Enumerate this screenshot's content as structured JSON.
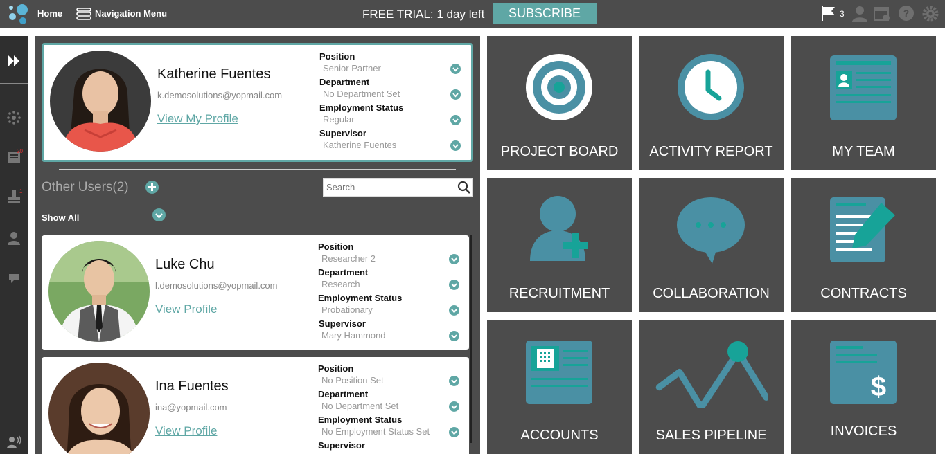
{
  "topbar": {
    "home": "Home",
    "nav_menu": "Navigation Menu",
    "trial": "FREE TRIAL: 1 day left",
    "subscribe": "SUBSCRIBE",
    "flag_count": "3"
  },
  "sidebar": {
    "badge_1": "20",
    "badge_2": "1"
  },
  "current_user": {
    "name": "Katherine Fuentes",
    "email": "k.demosolutions@yopmail.com",
    "link": "View My Profile",
    "fields": [
      {
        "label": "Position",
        "value": "Senior Partner"
      },
      {
        "label": "Department",
        "value": "No Department Set"
      },
      {
        "label": "Employment Status",
        "value": "Regular"
      },
      {
        "label": "Supervisor",
        "value": "Katherine Fuentes"
      }
    ]
  },
  "other_users": {
    "title": "Other Users(2)",
    "search_placeholder": "Search",
    "show_all": "Show All",
    "users": [
      {
        "name": "Luke Chu",
        "email": "l.demosolutions@yopmail.com",
        "link": "View Profile",
        "fields": [
          {
            "label": "Position",
            "value": "Researcher 2"
          },
          {
            "label": "Department",
            "value": "Research"
          },
          {
            "label": "Employment Status",
            "value": "Probationary"
          },
          {
            "label": "Supervisor",
            "value": "Mary Hammond"
          }
        ]
      },
      {
        "name": "Ina Fuentes",
        "email": "ina@yopmail.com",
        "link": "View Profile",
        "fields": [
          {
            "label": "Position",
            "value": "No Position Set"
          },
          {
            "label": "Department",
            "value": "No Department Set"
          },
          {
            "label": "Employment Status",
            "value": "No Employment Status Set"
          },
          {
            "label": "Supervisor",
            "value": ""
          }
        ]
      }
    ]
  },
  "tiles": [
    {
      "label": "PROJECT BOARD",
      "icon": "target-icon"
    },
    {
      "label": "ACTIVITY REPORT",
      "icon": "clock-icon"
    },
    {
      "label": "MY TEAM",
      "icon": "id-card-icon"
    },
    {
      "label": "RECRUITMENT",
      "icon": "add-person-icon"
    },
    {
      "label": "COLLABORATION",
      "icon": "chat-bubble-icon"
    },
    {
      "label": "CONTRACTS",
      "icon": "document-pen-icon"
    },
    {
      "label": "ACCOUNTS",
      "icon": "building-document-icon"
    },
    {
      "label": "SALES PIPELINE",
      "icon": "line-trend-icon"
    },
    {
      "label": "INVOICES",
      "icon": "dollar-document-icon"
    }
  ],
  "colors": {
    "accent": "#5fa7a5",
    "icon_blue": "#4a90a4",
    "panel": "#4c4c4c",
    "sidebar": "#2f2f2f"
  }
}
